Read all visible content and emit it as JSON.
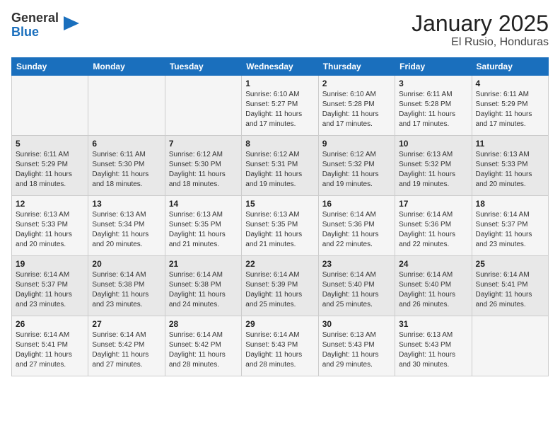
{
  "header": {
    "logo_general": "General",
    "logo_blue": "Blue",
    "month": "January 2025",
    "location": "El Rusio, Honduras"
  },
  "days_of_week": [
    "Sunday",
    "Monday",
    "Tuesday",
    "Wednesday",
    "Thursday",
    "Friday",
    "Saturday"
  ],
  "weeks": [
    [
      {
        "day": "",
        "sunrise": "",
        "sunset": "",
        "daylight": ""
      },
      {
        "day": "",
        "sunrise": "",
        "sunset": "",
        "daylight": ""
      },
      {
        "day": "",
        "sunrise": "",
        "sunset": "",
        "daylight": ""
      },
      {
        "day": "1",
        "sunrise": "Sunrise: 6:10 AM",
        "sunset": "Sunset: 5:27 PM",
        "daylight": "Daylight: 11 hours and 17 minutes."
      },
      {
        "day": "2",
        "sunrise": "Sunrise: 6:10 AM",
        "sunset": "Sunset: 5:28 PM",
        "daylight": "Daylight: 11 hours and 17 minutes."
      },
      {
        "day": "3",
        "sunrise": "Sunrise: 6:11 AM",
        "sunset": "Sunset: 5:28 PM",
        "daylight": "Daylight: 11 hours and 17 minutes."
      },
      {
        "day": "4",
        "sunrise": "Sunrise: 6:11 AM",
        "sunset": "Sunset: 5:29 PM",
        "daylight": "Daylight: 11 hours and 17 minutes."
      }
    ],
    [
      {
        "day": "5",
        "sunrise": "Sunrise: 6:11 AM",
        "sunset": "Sunset: 5:29 PM",
        "daylight": "Daylight: 11 hours and 18 minutes."
      },
      {
        "day": "6",
        "sunrise": "Sunrise: 6:11 AM",
        "sunset": "Sunset: 5:30 PM",
        "daylight": "Daylight: 11 hours and 18 minutes."
      },
      {
        "day": "7",
        "sunrise": "Sunrise: 6:12 AM",
        "sunset": "Sunset: 5:30 PM",
        "daylight": "Daylight: 11 hours and 18 minutes."
      },
      {
        "day": "8",
        "sunrise": "Sunrise: 6:12 AM",
        "sunset": "Sunset: 5:31 PM",
        "daylight": "Daylight: 11 hours and 19 minutes."
      },
      {
        "day": "9",
        "sunrise": "Sunrise: 6:12 AM",
        "sunset": "Sunset: 5:32 PM",
        "daylight": "Daylight: 11 hours and 19 minutes."
      },
      {
        "day": "10",
        "sunrise": "Sunrise: 6:13 AM",
        "sunset": "Sunset: 5:32 PM",
        "daylight": "Daylight: 11 hours and 19 minutes."
      },
      {
        "day": "11",
        "sunrise": "Sunrise: 6:13 AM",
        "sunset": "Sunset: 5:33 PM",
        "daylight": "Daylight: 11 hours and 20 minutes."
      }
    ],
    [
      {
        "day": "12",
        "sunrise": "Sunrise: 6:13 AM",
        "sunset": "Sunset: 5:33 PM",
        "daylight": "Daylight: 11 hours and 20 minutes."
      },
      {
        "day": "13",
        "sunrise": "Sunrise: 6:13 AM",
        "sunset": "Sunset: 5:34 PM",
        "daylight": "Daylight: 11 hours and 20 minutes."
      },
      {
        "day": "14",
        "sunrise": "Sunrise: 6:13 AM",
        "sunset": "Sunset: 5:35 PM",
        "daylight": "Daylight: 11 hours and 21 minutes."
      },
      {
        "day": "15",
        "sunrise": "Sunrise: 6:13 AM",
        "sunset": "Sunset: 5:35 PM",
        "daylight": "Daylight: 11 hours and 21 minutes."
      },
      {
        "day": "16",
        "sunrise": "Sunrise: 6:14 AM",
        "sunset": "Sunset: 5:36 PM",
        "daylight": "Daylight: 11 hours and 22 minutes."
      },
      {
        "day": "17",
        "sunrise": "Sunrise: 6:14 AM",
        "sunset": "Sunset: 5:36 PM",
        "daylight": "Daylight: 11 hours and 22 minutes."
      },
      {
        "day": "18",
        "sunrise": "Sunrise: 6:14 AM",
        "sunset": "Sunset: 5:37 PM",
        "daylight": "Daylight: 11 hours and 23 minutes."
      }
    ],
    [
      {
        "day": "19",
        "sunrise": "Sunrise: 6:14 AM",
        "sunset": "Sunset: 5:37 PM",
        "daylight": "Daylight: 11 hours and 23 minutes."
      },
      {
        "day": "20",
        "sunrise": "Sunrise: 6:14 AM",
        "sunset": "Sunset: 5:38 PM",
        "daylight": "Daylight: 11 hours and 23 minutes."
      },
      {
        "day": "21",
        "sunrise": "Sunrise: 6:14 AM",
        "sunset": "Sunset: 5:38 PM",
        "daylight": "Daylight: 11 hours and 24 minutes."
      },
      {
        "day": "22",
        "sunrise": "Sunrise: 6:14 AM",
        "sunset": "Sunset: 5:39 PM",
        "daylight": "Daylight: 11 hours and 25 minutes."
      },
      {
        "day": "23",
        "sunrise": "Sunrise: 6:14 AM",
        "sunset": "Sunset: 5:40 PM",
        "daylight": "Daylight: 11 hours and 25 minutes."
      },
      {
        "day": "24",
        "sunrise": "Sunrise: 6:14 AM",
        "sunset": "Sunset: 5:40 PM",
        "daylight": "Daylight: 11 hours and 26 minutes."
      },
      {
        "day": "25",
        "sunrise": "Sunrise: 6:14 AM",
        "sunset": "Sunset: 5:41 PM",
        "daylight": "Daylight: 11 hours and 26 minutes."
      }
    ],
    [
      {
        "day": "26",
        "sunrise": "Sunrise: 6:14 AM",
        "sunset": "Sunset: 5:41 PM",
        "daylight": "Daylight: 11 hours and 27 minutes."
      },
      {
        "day": "27",
        "sunrise": "Sunrise: 6:14 AM",
        "sunset": "Sunset: 5:42 PM",
        "daylight": "Daylight: 11 hours and 27 minutes."
      },
      {
        "day": "28",
        "sunrise": "Sunrise: 6:14 AM",
        "sunset": "Sunset: 5:42 PM",
        "daylight": "Daylight: 11 hours and 28 minutes."
      },
      {
        "day": "29",
        "sunrise": "Sunrise: 6:14 AM",
        "sunset": "Sunset: 5:43 PM",
        "daylight": "Daylight: 11 hours and 28 minutes."
      },
      {
        "day": "30",
        "sunrise": "Sunrise: 6:13 AM",
        "sunset": "Sunset: 5:43 PM",
        "daylight": "Daylight: 11 hours and 29 minutes."
      },
      {
        "day": "31",
        "sunrise": "Sunrise: 6:13 AM",
        "sunset": "Sunset: 5:43 PM",
        "daylight": "Daylight: 11 hours and 30 minutes."
      },
      {
        "day": "",
        "sunrise": "",
        "sunset": "",
        "daylight": ""
      }
    ]
  ]
}
